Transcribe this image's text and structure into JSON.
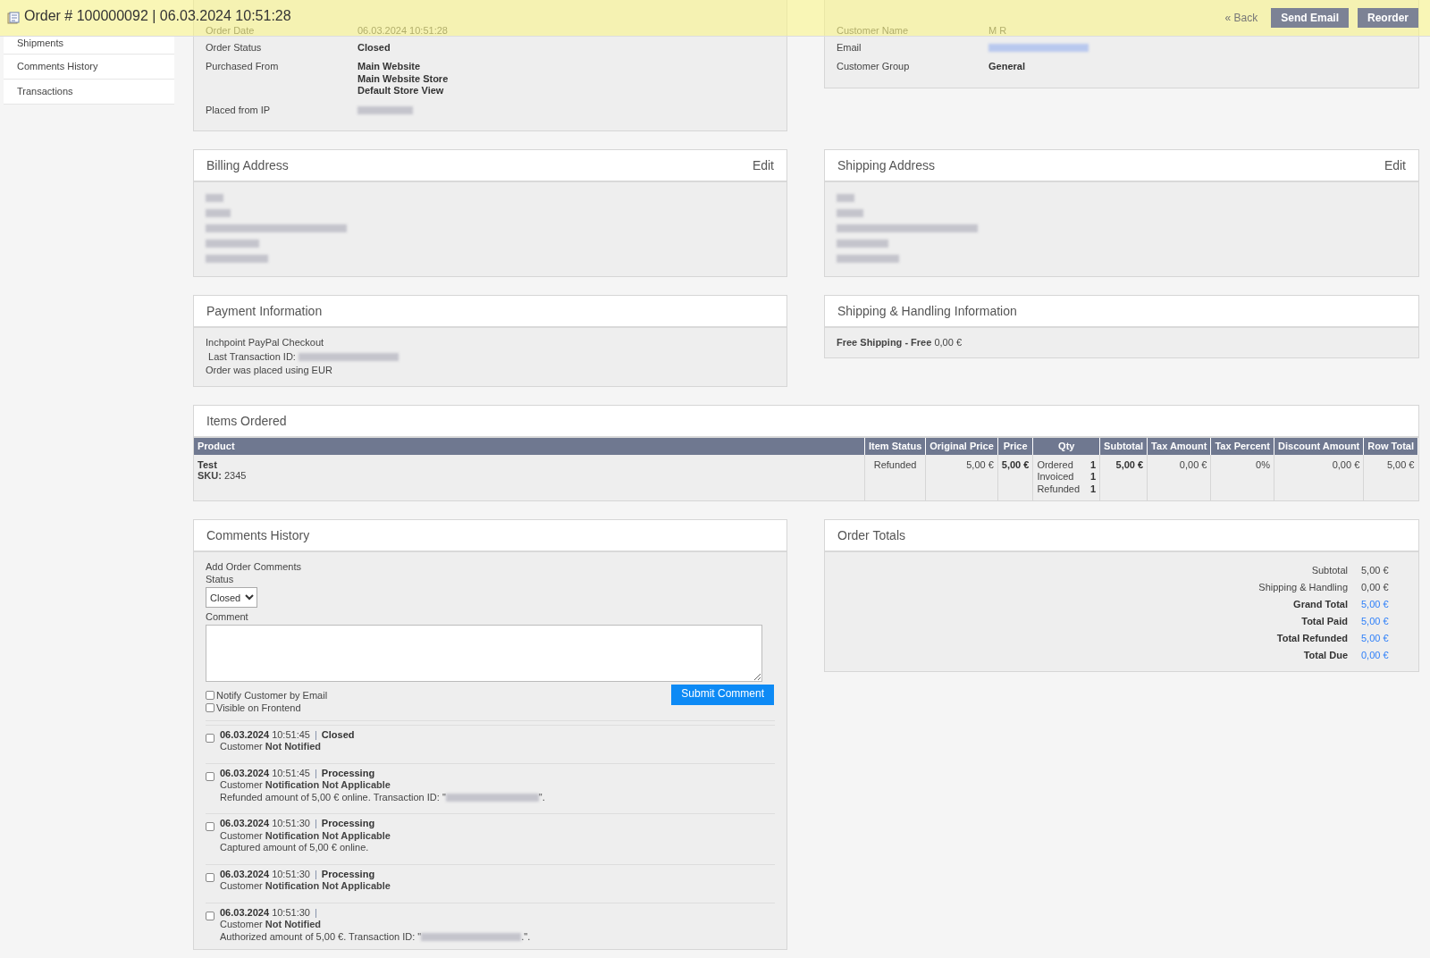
{
  "header": {
    "title": "Order # 100000092 | 06.03.2024 10:51:28",
    "back": "« Back",
    "buttons": [
      "Send Email",
      "Reorder"
    ]
  },
  "sidebar": {
    "items": [
      "Shipments",
      "Comments History",
      "Transactions"
    ]
  },
  "order_info": {
    "rows": [
      {
        "label": "Order Date",
        "kind": "faded",
        "value": [
          "06.03.2024 10:51:28"
        ]
      },
      {
        "label": "Order Status",
        "kind": "text",
        "value": [
          "Closed"
        ]
      },
      {
        "label": "Purchased From",
        "kind": "text",
        "value": [
          "Main Website",
          "Main Website Store",
          "Default Store View"
        ]
      },
      {
        "label": "Placed from IP",
        "kind": "redacted"
      }
    ]
  },
  "account_info": {
    "rows": [
      {
        "label": "Customer Name",
        "kind": "faded",
        "value": [
          "M R"
        ]
      },
      {
        "label": "Email",
        "kind": "redacted"
      },
      {
        "label": "Customer Group",
        "kind": "text",
        "value": [
          "General"
        ]
      }
    ]
  },
  "billing_address": {
    "title": "Billing Address",
    "action": "Edit"
  },
  "shipping_address": {
    "title": "Shipping Address",
    "action": "Edit"
  },
  "payment": {
    "title": "Payment Information",
    "method": "Inchpoint PayPal Checkout",
    "transaction_label": "Last Transaction ID:",
    "currency_note": "Order was placed using EUR"
  },
  "shipping_info": {
    "title": "Shipping & Handling Information",
    "text": "**Free Shipping - Free** 0,00 €"
  },
  "items": {
    "title": "Items Ordered",
    "columns": [
      "Product",
      "Item Status",
      "Original Price",
      "Price",
      "Qty",
      "Subtotal",
      "Tax Amount",
      "Tax Percent",
      "Discount Amount",
      "Row Total"
    ],
    "rows": [
      {
        "name": "Test",
        "sku": "**SKU:** 2345",
        "status": "Refunded",
        "original_price": "5,00 €",
        "price": "5,00 €",
        "qty": [
          {
            "label": "Ordered",
            "value": "1"
          },
          {
            "label": "Invoiced",
            "value": "1"
          },
          {
            "label": "Refunded",
            "value": "1"
          }
        ],
        "subtotal": "5,00 €",
        "tax_amount": "0,00 €",
        "tax_percent": "0%",
        "discount_amount": "0,00 €",
        "row_total": "5,00 €"
      }
    ]
  },
  "comments": {
    "title": "Comments History",
    "form_title": "Add Order Comments",
    "status_label": "Status",
    "status_value": "Closed",
    "comment_label": "Comment",
    "options": [
      {
        "label": "Notify Customer by Email",
        "checked": false
      },
      {
        "label": "Visible on Frontend",
        "checked": false
      }
    ],
    "submit": "Submit Comment",
    "history": [
      {
        "checked": false,
        "date": "06.03.2024",
        "time": "10:51:45",
        "separator": "|",
        "status": "Closed",
        "notice": "Customer **Not Notified**"
      },
      {
        "checked": false,
        "date": "06.03.2024",
        "time": "10:51:45",
        "separator": "|",
        "status": "Processing",
        "notice": "Customer **Notification Not Applicable**",
        "note": "Refunded amount of 5,00 € online. Transaction ID: \"",
        "note_after": "\"."
      },
      {
        "checked": false,
        "date": "06.03.2024",
        "time": "10:51:30",
        "separator": "|",
        "status": "Processing",
        "notice": "Customer **Notification Not Applicable**",
        "note": "Captured amount of 5,00 € online."
      },
      {
        "checked": false,
        "date": "06.03.2024",
        "time": "10:51:30",
        "separator": "|",
        "status": "Processing",
        "notice": "Customer **Notification Not Applicable**"
      },
      {
        "checked": false,
        "date": "06.03.2024",
        "time": "10:51:30",
        "separator": "|",
        "notice": "Customer **Not Notified**",
        "note": "Authorized amount of 5,00 €. Transaction ID: \"",
        "note_after": ".\"."
      }
    ]
  },
  "totals": {
    "title": "Order Totals",
    "rows": [
      {
        "label": "Subtotal",
        "value": "5,00 €",
        "kind": "plain"
      },
      {
        "label": "Shipping & Handling",
        "value": "0,00 €",
        "kind": "plain"
      },
      {
        "label": "Grand Total",
        "value": "5,00 €",
        "kind": "strong"
      },
      {
        "label": "Total Paid",
        "value": "5,00 €",
        "kind": "strong"
      },
      {
        "label": "Total Refunded",
        "value": "5,00 €",
        "kind": "strong"
      },
      {
        "label": "Total Due",
        "value": "0,00 €",
        "kind": "strong"
      }
    ]
  }
}
